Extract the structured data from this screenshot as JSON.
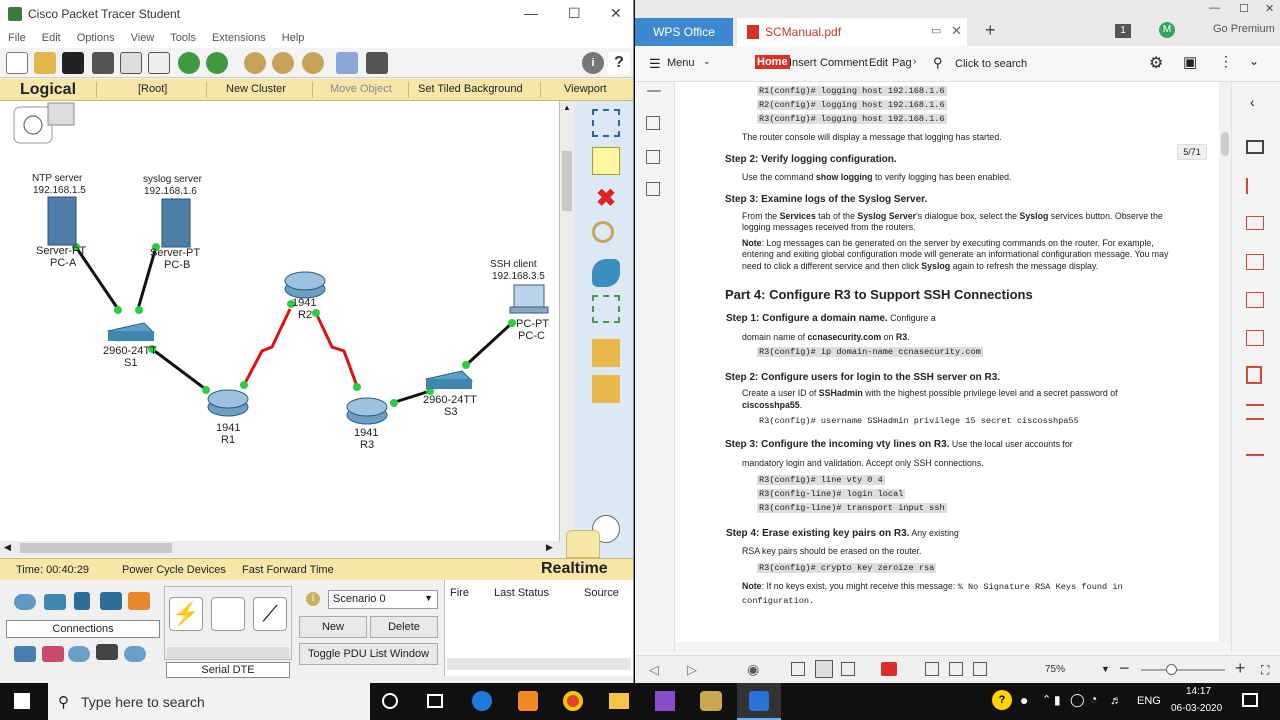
{
  "pt": {
    "title": "Cisco Packet Tracer Student",
    "menu": [
      "File",
      "Edit",
      "Options",
      "View",
      "Tools",
      "Extensions",
      "Help"
    ],
    "bar": {
      "logical": "Logical",
      "root": "[Root]",
      "new_cluster": "New Cluster",
      "move_object": "Move Object",
      "set_tiled": "Set Tiled Background",
      "viewport": "Viewport"
    },
    "devices": {
      "ntp_label": "NTP server",
      "ntp_ip": "192.168.1.5",
      "pca_type": "Server-PT",
      "pca_name": "PC-A",
      "syslog_label": "syslog server",
      "syslog_ip": "192.168.1.6",
      "pcb_type": "Server-PT",
      "pcb_name": "PC-B",
      "s1_type": "2960-24TT",
      "s1_name": "S1",
      "r1_type": "1941",
      "r1_name": "R1",
      "r2_type": "1941",
      "r2_name": "R2",
      "r3_type": "1941",
      "r3_name": "R3",
      "s3_type": "2960-24TT",
      "s3_name": "S3",
      "ssh_label": "SSH client",
      "ssh_ip": "192.168.3.5",
      "pcc_type": "PC-PT",
      "pcc_name": "PC-C"
    },
    "status": {
      "time": "Time: 00:40:29",
      "power": "Power Cycle Devices",
      "fast": "Fast Forward Time",
      "mode": "Realtime"
    },
    "bottom": {
      "connections": "Connections",
      "serial": "Serial DTE",
      "scenario": "Scenario 0",
      "new": "New",
      "delete": "Delete",
      "toggle": "Toggle PDU List Window",
      "col_fire": "Fire",
      "col_status": "Last Status",
      "col_source": "Source"
    }
  },
  "wps": {
    "tab_wps": "WPS Office",
    "tab_pdf": "SCManual.pdf",
    "badge": "1",
    "avatar": "M",
    "premium": "Go Premium",
    "ribbon": {
      "menu": "Menu",
      "home": "Home",
      "insert": "Insert",
      "comment": "Comment",
      "edit": "Edit",
      "page": "Pag",
      "search": "Click to search"
    },
    "page_indicator": "5/71",
    "zoom": "75%"
  },
  "doc": {
    "c1": "R1(config)# logging host 192.168.1.6",
    "c2": "R2(config)# logging host 192.168.1.6",
    "c3": "R3(config)# logging host 192.168.1.6",
    "p1": "The router console will display a message that logging has started.",
    "s2_title": "Step 2: Verify logging configuration.",
    "s2_a": "Use the command ",
    "s2_b": "show logging",
    "s2_c": " to verify logging has been enabled.",
    "s3_title": "Step 3: Examine logs of the Syslog Server.",
    "s3_l1a": "From the ",
    "s3_l1b": "Services",
    "s3_l1c": " tab of the ",
    "s3_l1d": "Syslog Server",
    "s3_l1e": "'s dialogue box, select the ",
    "s3_l1f": "Syslog",
    "s3_l1g": " services button. Observe the",
    "s3_l2": "logging messages received from the routers.",
    "note1_a": "Note",
    "note1_b": ": Log messages can be generated on the server by executing commands on the router. For example,",
    "note1_l2": "entering and exiting global configuration mode will generate an informational configuration message. You may",
    "note1_l3a": "need to click a different service and then click ",
    "note1_l3b": "Syslog",
    "note1_l3c": " again to refresh the message display.",
    "part4": "Part 4: Configure R3 to Support SSH Connections",
    "p4s1_title": "Step 1: Configure a domain name.",
    "p4s1_tail": " Configure a",
    "p4s1_l2a": "domain name of ",
    "p4s1_l2b": "ccnasecurity.com",
    "p4s1_l2c": " on ",
    "p4s1_l2d": "R3",
    "p4s1_l2e": ".",
    "p4s1_code": "R3(config)# ip domain-name ccnasecurity.com",
    "p4s2_title": "Step 2: Configure users for login to the SSH server on R3.",
    "p4s2_l1a": "Create a user ID of ",
    "p4s2_l1b": "SSHadmin",
    "p4s2_l1c": " with the highest possible privilege level and a secret password of",
    "p4s2_l2": "ciscosshpa55",
    "p4s2_l2b": ".",
    "p4s2_code": "R3(config)# username SSHadmin privilege 15 secret ciscosshpa55",
    "p4s3_title": "Step 3: Configure the incoming vty lines on R3.",
    "p4s3_tail": " Use the local user accounts for",
    "p4s3_l2": "mandatory login and validation. Accept only SSH connections.",
    "p4s3_c1": "R3(config)# line vty 0 4",
    "p4s3_c2": "R3(config-line)# login local",
    "p4s3_c3": "R3(config-line)# transport input ssh",
    "p4s4_title": "Step 4: Erase existing key pairs on R3.",
    "p4s4_tail": " Any existing",
    "p4s4_l2": "RSA key pairs should be erased on the router.",
    "p4s4_code": "R3(config)# crypto key zeroize rsa",
    "note2_a": "Note",
    "note2_b": ": If no keys exist, you might receive this message: ",
    "note2_code": "% No Signature RSA Keys found in",
    "note2_code2": "configuration."
  },
  "taskbar": {
    "search": "Type here to search",
    "lang": "ENG",
    "time": "14:17",
    "date": "06-03-2020"
  }
}
